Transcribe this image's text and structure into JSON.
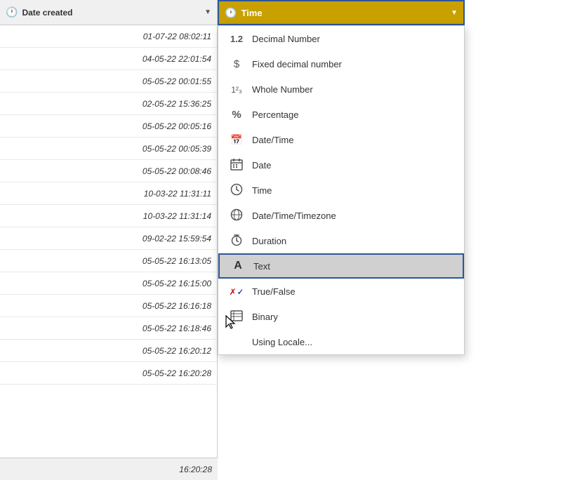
{
  "dateColumn": {
    "icon": "🕐",
    "label": "Date created",
    "dropdownArrow": "▼",
    "rows": [
      {
        "value": "01-07-22 08:02:11"
      },
      {
        "value": "04-05-22 22:01:54"
      },
      {
        "value": "05-05-22 00:01:55"
      },
      {
        "value": "02-05-22 15:36:25"
      },
      {
        "value": "05-05-22 00:05:16"
      },
      {
        "value": "05-05-22 00:05:39"
      },
      {
        "value": "05-05-22 00:08:46"
      },
      {
        "value": "10-03-22 11:31:11"
      },
      {
        "value": "10-03-22 11:31:14"
      },
      {
        "value": "09-02-22 15:59:54"
      },
      {
        "value": "05-05-22 16:13:05"
      },
      {
        "value": "05-05-22 16:15:00"
      },
      {
        "value": "05-05-22 16:16:18"
      },
      {
        "value": "05-05-22 16:18:46"
      },
      {
        "value": "05-05-22 16:20:12"
      },
      {
        "value": "05-05-22 16:20:28"
      }
    ],
    "footerValue": "16:20:28"
  },
  "timeColumn": {
    "icon": "🕐",
    "label": "Time",
    "dropdownArrow": "▼"
  },
  "dropdownMenu": {
    "items": [
      {
        "id": "decimal",
        "iconText": "1.2",
        "label": "Decimal Number",
        "iconType": "text"
      },
      {
        "id": "fixed-decimal",
        "iconText": "$",
        "label": "Fixed decimal number",
        "iconType": "text"
      },
      {
        "id": "whole-number",
        "iconText": "1²₃",
        "label": "Whole Number",
        "iconType": "text"
      },
      {
        "id": "percentage",
        "iconText": "%",
        "label": "Percentage",
        "iconType": "text"
      },
      {
        "id": "datetime",
        "iconText": "📅",
        "label": "Date/Time",
        "iconType": "emoji"
      },
      {
        "id": "date",
        "iconText": "📅",
        "label": "Date",
        "iconType": "emoji"
      },
      {
        "id": "time",
        "iconText": "🕐",
        "label": "Time",
        "iconType": "emoji"
      },
      {
        "id": "datetime-timezone",
        "iconText": "🌐",
        "label": "Date/Time/Timezone",
        "iconType": "emoji"
      },
      {
        "id": "duration",
        "iconText": "⏱",
        "label": "Duration",
        "iconType": "emoji"
      },
      {
        "id": "text",
        "iconText": "A",
        "label": "Text",
        "iconType": "text",
        "selected": true
      },
      {
        "id": "truefalse",
        "iconText": "✗✓",
        "label": "True/False",
        "iconType": "truefalse"
      },
      {
        "id": "binary",
        "iconText": "☰",
        "label": "Binary",
        "iconType": "text"
      },
      {
        "id": "locale",
        "iconText": "",
        "label": "Using Locale...",
        "iconType": "none"
      }
    ]
  }
}
